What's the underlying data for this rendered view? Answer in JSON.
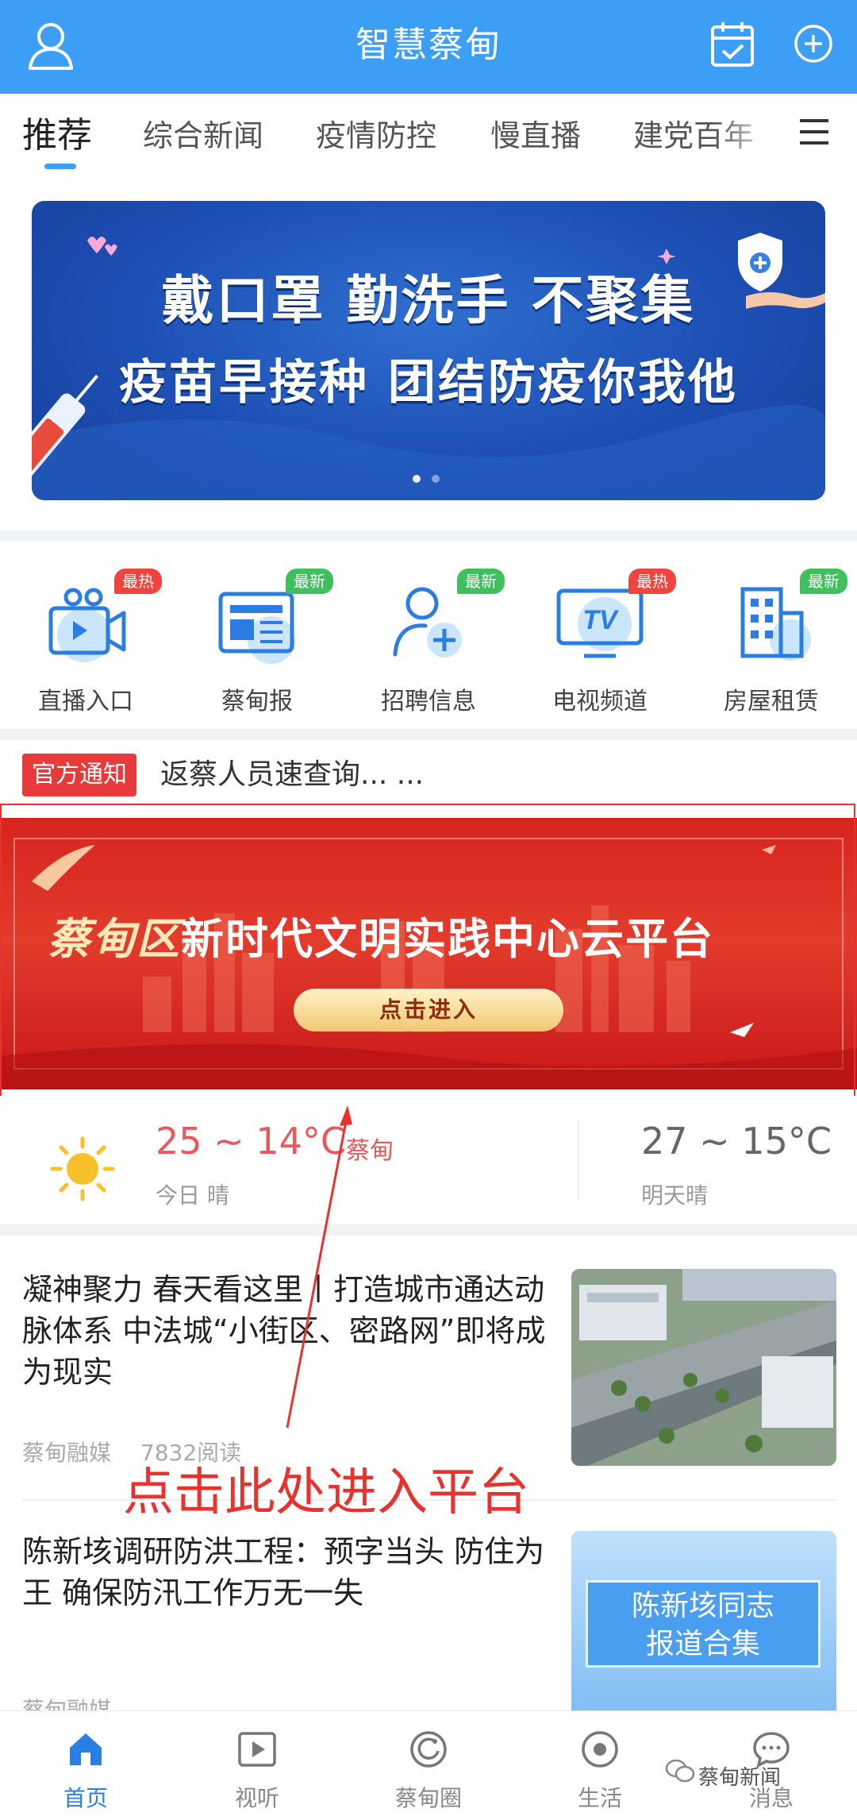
{
  "header": {
    "title": "智慧蔡甸"
  },
  "tabs": [
    {
      "label": "推荐"
    },
    {
      "label": "综合新闻"
    },
    {
      "label": "疫情防控"
    },
    {
      "label": "慢直播"
    },
    {
      "label": "建党百年"
    }
  ],
  "banner1": {
    "line1": "戴口罩 勤洗手 不聚集",
    "line2": "疫苗早接种 团结防疫你我他"
  },
  "quick": [
    {
      "label": "直播入口",
      "badge": "最热",
      "icon": "video-camera-icon"
    },
    {
      "label": "蔡甸报",
      "badge": "最新",
      "icon": "newspaper-icon"
    },
    {
      "label": "招聘信息",
      "badge": "最新",
      "icon": "add-user-icon"
    },
    {
      "label": "电视频道",
      "badge": "最热",
      "icon": "tv-icon"
    },
    {
      "label": "房屋租赁",
      "badge": "最新",
      "icon": "building-icon"
    }
  ],
  "notice": {
    "tag": "官方通知",
    "text": "返蔡人员速查询... ..."
  },
  "banner2": {
    "title_em": "蔡甸区",
    "title_rest": "新时代文明实践中心云平台",
    "button": "点击进入"
  },
  "weather": {
    "today": {
      "temp": "25 ~ 14°C",
      "location": "蔡甸",
      "desc": "今日 晴"
    },
    "tomorrow": {
      "temp": "27 ~ 15°C",
      "desc": "明天晴"
    }
  },
  "news": [
    {
      "title": "凝神聚力 春天看这里丨打造城市通达动脉体系 中法城“小街区、密路网”即将成为现实",
      "source": "蔡甸融媒",
      "reads": "7832阅读"
    },
    {
      "title": "陈新垓调研防洪工程：预字当头 防住为王 确保防汛工作万无一失",
      "source": "蔡甸融媒",
      "thumb_text": "陈新垓同志\n报道合集"
    }
  ],
  "annotation": "点击此处进入平台",
  "nav": [
    {
      "label": "首页",
      "icon": "home-icon"
    },
    {
      "label": "视听",
      "icon": "play-icon"
    },
    {
      "label": "蔡甸圈",
      "icon": "circle-icon"
    },
    {
      "label": "生活",
      "icon": "life-icon"
    },
    {
      "label": "消息",
      "icon": "chat-icon"
    }
  ],
  "watermark": "蔡甸新闻",
  "colors": {
    "brand": "#3d9ef5",
    "red": "#e8322e"
  }
}
